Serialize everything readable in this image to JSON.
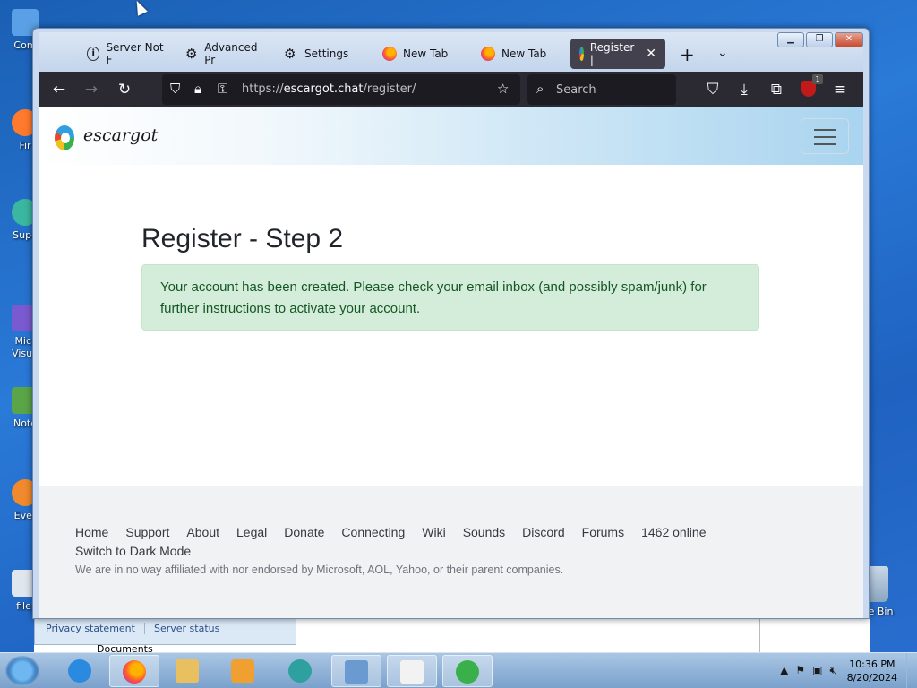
{
  "desktop": {
    "icons": [
      {
        "label": "Com",
        "color": "#5aa0e6"
      },
      {
        "label": "Fir",
        "color": "#ff7a2c"
      },
      {
        "label": "Supe",
        "color": "#3bb6a0"
      },
      {
        "label": "Micr\nVisua",
        "color": "#7a5ad0"
      },
      {
        "label": "Note",
        "color": "#5aa548"
      },
      {
        "label": "Ever",
        "color": "#f08a2c"
      },
      {
        "label": "filel",
        "color": "#e0e6ee"
      }
    ],
    "recycle_bin": "cle Bin"
  },
  "behind_window": {
    "links": [
      "Privacy statement",
      "Server status"
    ],
    "documents": "Documents"
  },
  "browser": {
    "tabs": [
      {
        "label": "Server Not F",
        "icon": "info-icon"
      },
      {
        "label": "Advanced Pr",
        "icon": "gear-icon"
      },
      {
        "label": "Settings",
        "icon": "gear-icon"
      },
      {
        "label": "New Tab",
        "icon": "firefox-icon"
      },
      {
        "label": "New Tab",
        "icon": "firefox-icon"
      },
      {
        "label": "Register |",
        "icon": "escargot-icon",
        "active": true
      }
    ],
    "new_tab": "+",
    "tab_list": "⌄",
    "url_scheme": "https://",
    "url_host": "escargot.chat",
    "url_path": "/register/",
    "search_placeholder": "Search",
    "extension_badge": "1"
  },
  "site": {
    "brand": "escargot",
    "title": "Register - Step 2",
    "alert": "Your account has been created. Please check your email inbox (and possibly spam/junk) for further instructions to activate your account.",
    "footer": {
      "nav": [
        "Home",
        "Support",
        "About",
        "Legal",
        "Donate",
        "Connecting",
        "Wiki",
        "Sounds",
        "Discord",
        "Forums",
        "1462 online"
      ],
      "dark_mode": "Switch to Dark Mode",
      "disclaimer": "We are in no way affiliated with nor endorsed by Microsoft, AOL, Yahoo, or their parent companies."
    }
  },
  "taskbar": {
    "time": "10:36 PM",
    "date": "8/20/2024"
  }
}
